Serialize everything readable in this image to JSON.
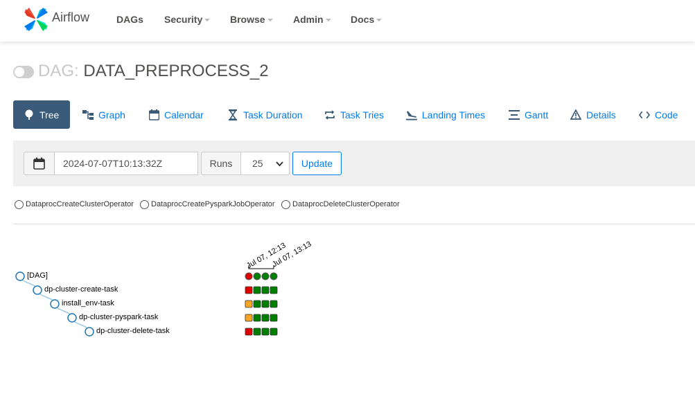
{
  "app": {
    "brand": "Airflow"
  },
  "nav": {
    "items": [
      {
        "label": "DAGs"
      },
      {
        "label": "Security"
      },
      {
        "label": "Browse"
      },
      {
        "label": "Admin"
      },
      {
        "label": "Docs"
      }
    ]
  },
  "dag": {
    "prefix": "DAG:",
    "name": "DATA_PREPROCESS_2",
    "paused": true
  },
  "tabs": [
    {
      "label": "Tree",
      "icon": "tree-icon",
      "active": true
    },
    {
      "label": "Graph",
      "icon": "graph-icon"
    },
    {
      "label": "Calendar",
      "icon": "calendar-icon"
    },
    {
      "label": "Task Duration",
      "icon": "hourglass-icon"
    },
    {
      "label": "Task Tries",
      "icon": "retry-icon"
    },
    {
      "label": "Landing Times",
      "icon": "landing-icon"
    },
    {
      "label": "Gantt",
      "icon": "gantt-icon"
    },
    {
      "label": "Details",
      "icon": "warning-triangle-icon"
    },
    {
      "label": "Code",
      "icon": "code-icon"
    }
  ],
  "toolbar": {
    "date_value": "2024-07-07T10:13:32Z",
    "runs_label": "Runs",
    "runs_value": "25",
    "update_label": "Update"
  },
  "legend": {
    "operators": [
      "DataprocCreateClusterOperator",
      "DataprocCreatePysparkJobOperator",
      "DataprocDeleteClusterOperator"
    ]
  },
  "tree": {
    "run_dates": [
      "Jul 07, 12:13",
      "Jul 07, 13:13"
    ],
    "nodes": [
      "[DAG]",
      "dp-cluster-create-task",
      "install_env-task",
      "dp-cluster-pyspark-task",
      "dp-cluster-delete-task"
    ],
    "status_rows": [
      [
        "failed",
        "success",
        "success",
        "success"
      ],
      [
        "failed",
        "success",
        "success",
        "success"
      ],
      [
        "up_for_retry",
        "success",
        "success",
        "success"
      ],
      [
        "up_for_retry",
        "success",
        "success",
        "success"
      ],
      [
        "failed",
        "success",
        "success",
        "success"
      ]
    ]
  },
  "colors": {
    "accent": "#017cee",
    "active_tab": "#3a5a79",
    "failed": "#e00000",
    "success": "#008000",
    "up_for_retry": "#f5a623",
    "tree_link": "#9ecae1",
    "node_stroke": "#1f77b4"
  }
}
